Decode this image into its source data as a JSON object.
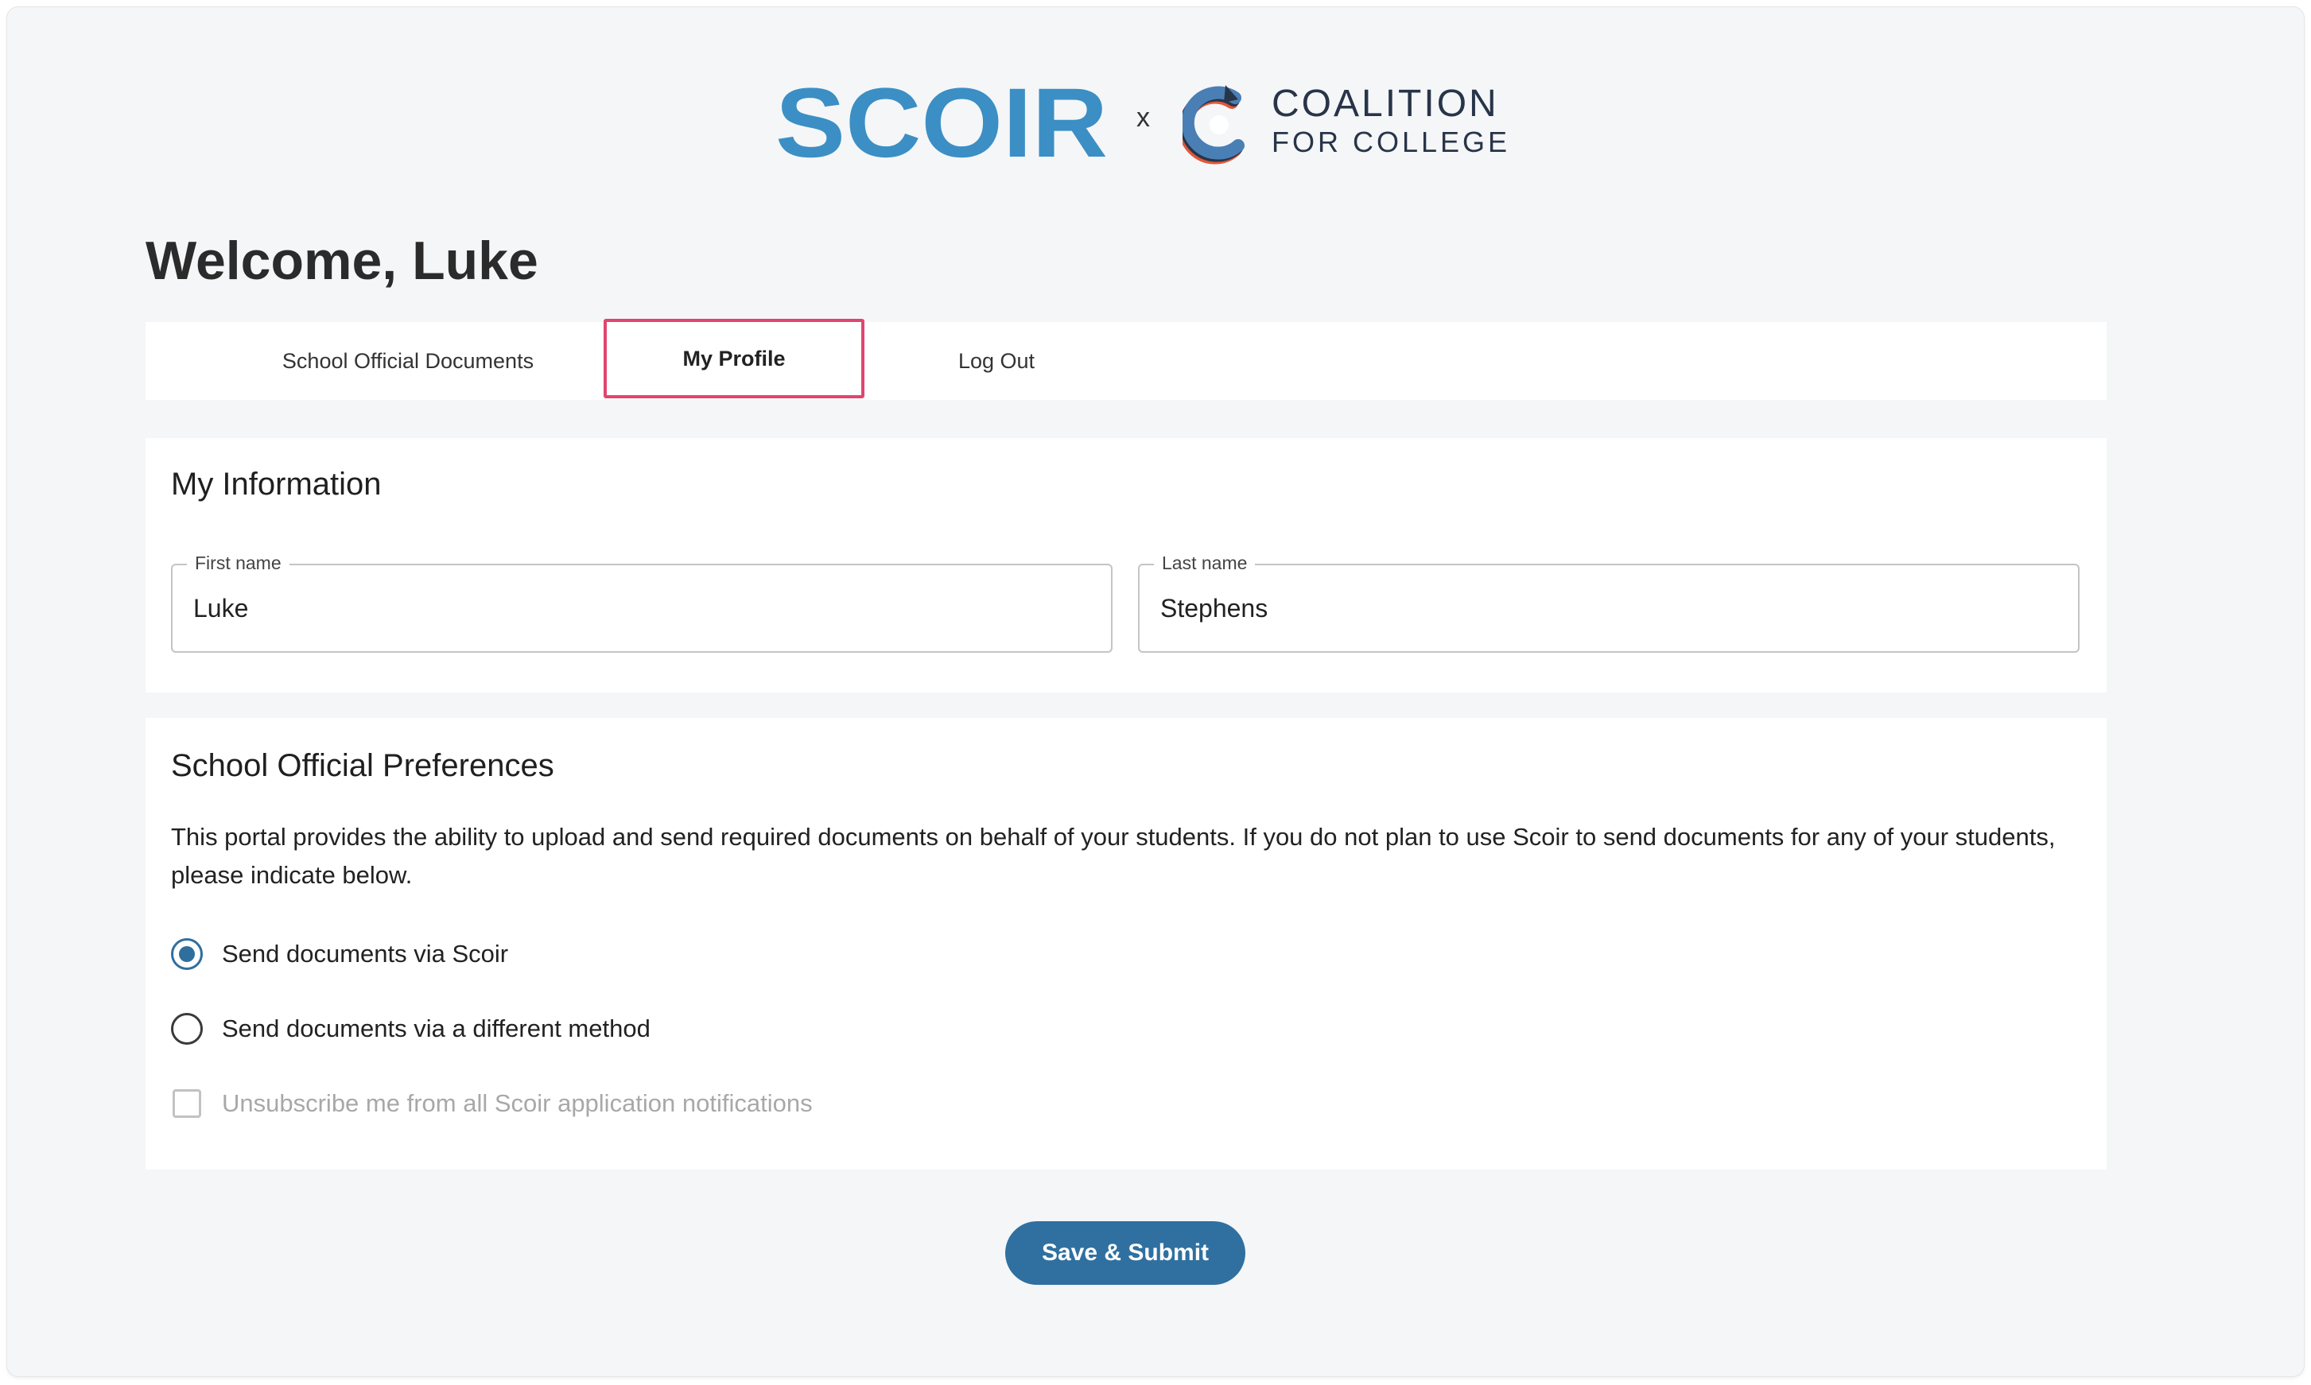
{
  "brand": {
    "scoir_logo_text": "SCOIR",
    "separator": "x",
    "coalition_line1": "COALITION",
    "coalition_line2": "FOR COLLEGE",
    "colors": {
      "scoir_blue": "#3b8fc4",
      "coalition_navy": "#283548",
      "coalition_blue": "#4a7fb5",
      "coalition_orange": "#e0583a"
    }
  },
  "welcome": "Welcome, Luke",
  "tabs": [
    {
      "label": "School Official Documents",
      "active": false
    },
    {
      "label": "My Profile",
      "active": true,
      "highlighted": true
    },
    {
      "label": "Log Out",
      "active": false
    }
  ],
  "my_information": {
    "title": "My Information",
    "first_name": {
      "label": "First name",
      "value": "Luke"
    },
    "last_name": {
      "label": "Last name",
      "value": "Stephens"
    }
  },
  "preferences": {
    "title": "School Official Preferences",
    "description": "This portal provides the ability to upload and send required documents on behalf of your students. If you do not plan to use Scoir to send documents for any of your students, please indicate below.",
    "options": [
      {
        "label": "Send documents via Scoir",
        "type": "radio",
        "checked": true
      },
      {
        "label": "Send documents via a different method",
        "type": "radio",
        "checked": false
      },
      {
        "label": "Unsubscribe me from all Scoir application notifications",
        "type": "checkbox",
        "checked": false,
        "disabled": true
      }
    ]
  },
  "submit": {
    "label": "Save & Submit",
    "color": "#2f70a0"
  },
  "highlight_color": "#e0466f",
  "icons": {
    "radio_checked": "radio-checked-icon",
    "radio_unchecked": "radio-unchecked-icon",
    "checkbox_unchecked": "checkbox-unchecked-icon"
  }
}
